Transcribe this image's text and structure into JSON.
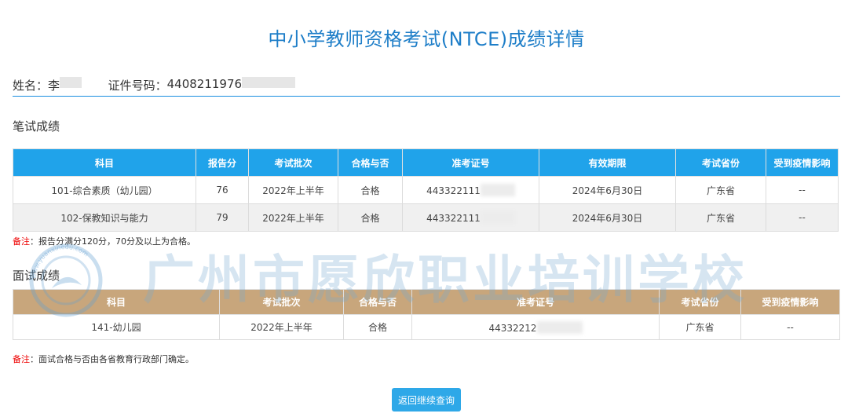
{
  "page": {
    "title": "中小学教师资格考试(NTCE)成绩详情"
  },
  "candidate": {
    "name_label": "姓名：",
    "name_value": "李",
    "id_label": "证件号码：",
    "id_value": "4408211976"
  },
  "written": {
    "section_title": "笔试成绩",
    "headers": [
      "科目",
      "报告分",
      "考试批次",
      "合格与否",
      "准考证号",
      "有效期限",
      "考试省份",
      "受到疫情影响"
    ],
    "rows": [
      {
        "subject": "101-综合素质（幼儿园）",
        "score": "76",
        "batch": "2022年上半年",
        "pass": "合格",
        "ticket": "443322111",
        "valid": "2024年6月30日",
        "province": "广东省",
        "covid": "--"
      },
      {
        "subject": "102-保教知识与能力",
        "score": "79",
        "batch": "2022年上半年",
        "pass": "合格",
        "ticket": "443322111",
        "valid": "2024年6月30日",
        "province": "广东省",
        "covid": "--"
      }
    ],
    "note_label": "备注",
    "note_text": "：报告分满分120分，70分及以上为合格。"
  },
  "interview": {
    "section_title": "面试成绩",
    "headers": [
      "科目",
      "考试批次",
      "合格与否",
      "准考证号",
      "考试省份",
      "受到疫情影响"
    ],
    "rows": [
      {
        "subject": "141-幼儿园",
        "batch": "2022年上半年",
        "pass": "合格",
        "ticket": "44332212",
        "province": "广东省",
        "covid": "--"
      }
    ],
    "note_label": "备注",
    "note_text": "：面试合格与否由各省教育行政部门确定。"
  },
  "actions": {
    "back_button": "返回继续查询"
  },
  "watermark": {
    "text": "广州市愿欣职业培训学校",
    "url": "www.yuanxinedu.com"
  },
  "colors": {
    "accent": "#20a3ea",
    "interview_header": "#c8a67c",
    "note_label": "#e00000"
  }
}
